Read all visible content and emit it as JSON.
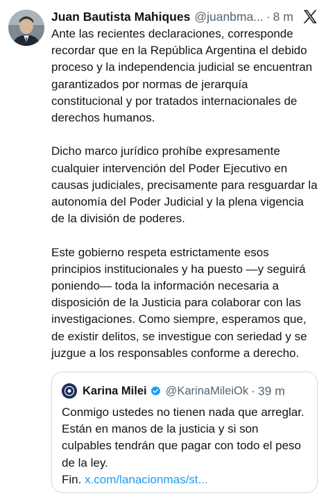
{
  "tweet": {
    "author_name": "Juan Bautista Mahiques",
    "author_handle": "@juanbma...",
    "separator": "·",
    "timestamp": "8 m",
    "logo_icon": "x-logo-icon",
    "paragraphs": [
      "Ante las recientes declaraciones, corresponde recordar que en la República Argentina el debido proceso y la independencia judicial se encuentran garantizados por normas de jerarquía constitucional y por tratados internacionales de derechos humanos.",
      "Dicho marco jurídico prohíbe expresamente cualquier intervención del Poder Ejecutivo en causas judiciales, precisamente para resguardar la autonomía del Poder Judicial y la plena vigencia de la división de poderes.",
      "Este gobierno respeta estrictamente esos principios institucionales y ha puesto —y seguirá poniendo— toda la información necesaria a disposición de la Justicia para colaborar con las investigaciones. Como siempre, esperamos que, de existir delitos, se investigue con seriedad y se juzgue a los responsables conforme a derecho."
    ]
  },
  "quote": {
    "author_name": "Karina Milei",
    "verified_icon": "verified-badge-icon",
    "author_handle": "@KarinaMileiOk",
    "separator": "·",
    "timestamp": "39 m",
    "text": "Conmigo ustedes no tienen nada que arreglar. Están en manos de la justicia y si son culpables tendrán que pagar con todo el peso de la ley.",
    "text_suffix": "Fin.",
    "link_text": "x.com/lanacionmas/st..."
  },
  "colors": {
    "text": "#0f1419",
    "secondary": "#536471",
    "link": "#1d9bf0",
    "border": "#cfd9de",
    "verified": "#1d9bf0"
  }
}
